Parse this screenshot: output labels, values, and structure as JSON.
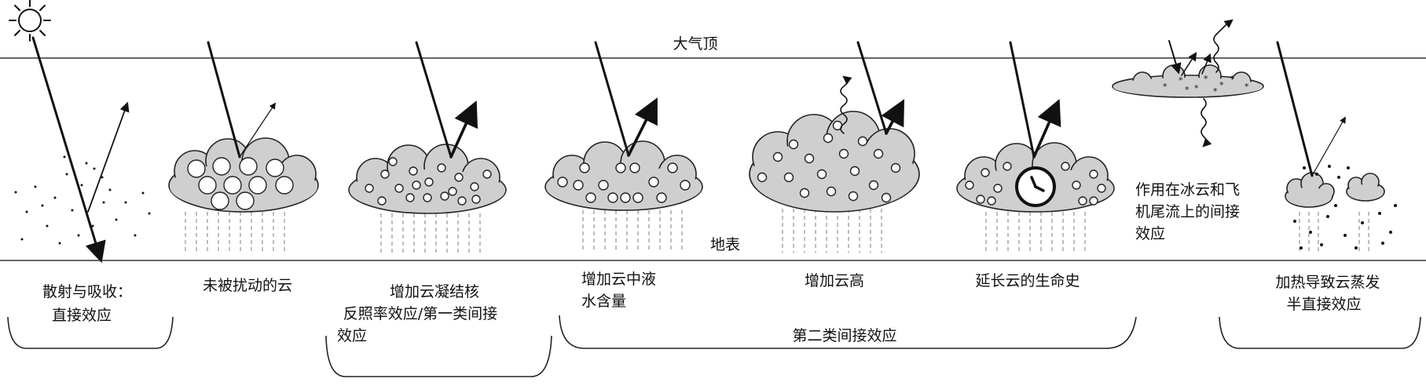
{
  "labels": {
    "toa": "大气顶",
    "surface": "地表"
  },
  "panels": [
    {
      "id": "scatter",
      "lines": [
        "散射与吸收：",
        "直接效应"
      ]
    },
    {
      "id": "unperturbed",
      "lines": [
        "未被扰动的云"
      ]
    },
    {
      "id": "ccn",
      "lines": [
        "增加云凝结核",
        "反照率效应/第一类间接",
        "效应"
      ]
    },
    {
      "id": "lwc",
      "lines": [
        "增加云中液",
        "水含量"
      ]
    },
    {
      "id": "height",
      "lines": [
        "增加云高"
      ]
    },
    {
      "id": "lifetime",
      "lines": [
        "延长云的生命史"
      ]
    },
    {
      "id": "ice",
      "lines": [
        "作用在冰云和飞",
        "机尾流上的间接",
        "效应"
      ]
    },
    {
      "id": "semidirect",
      "lines": [
        "加热导致云蒸发",
        "半直接效应"
      ]
    }
  ],
  "groups": {
    "second_indirect": "第二类间接效应"
  },
  "icons": {
    "sun": "sun-icon",
    "clock": "clock-icon"
  }
}
